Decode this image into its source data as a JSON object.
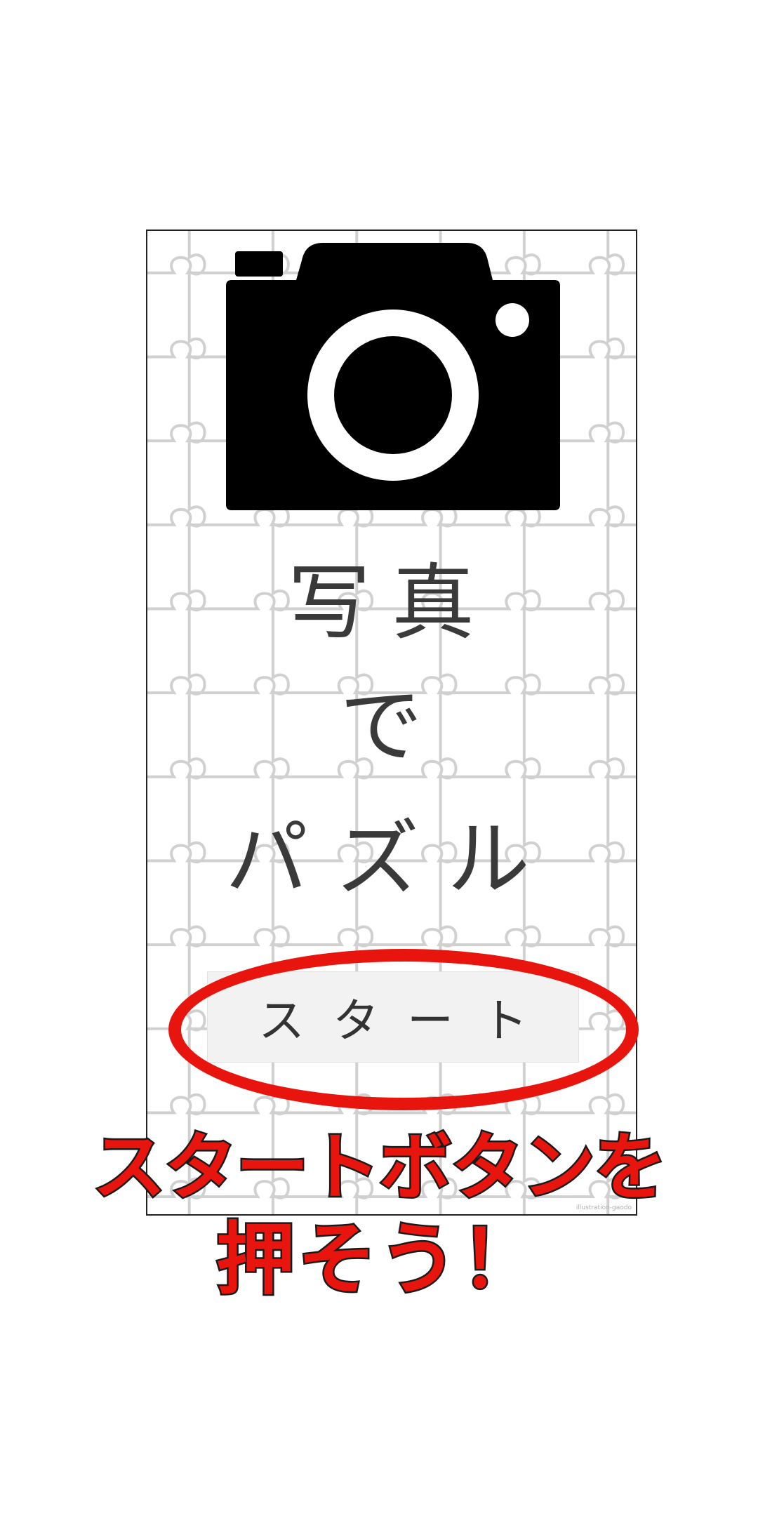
{
  "app": {
    "title_lines": [
      "写真",
      "で",
      "パズル"
    ],
    "start_button_label": "スタート",
    "watermark": "illustration-gaodo"
  },
  "camera": {
    "icon": "camera-icon"
  },
  "annotation": {
    "caption_line1": "スタートボタンを",
    "caption_line2": "押そう！",
    "highlight_color": "#e8150f"
  },
  "colors": {
    "title_text": "#3a3a3a",
    "button_bg": "#f2f2f2",
    "annotation_red": "#e8150f"
  }
}
